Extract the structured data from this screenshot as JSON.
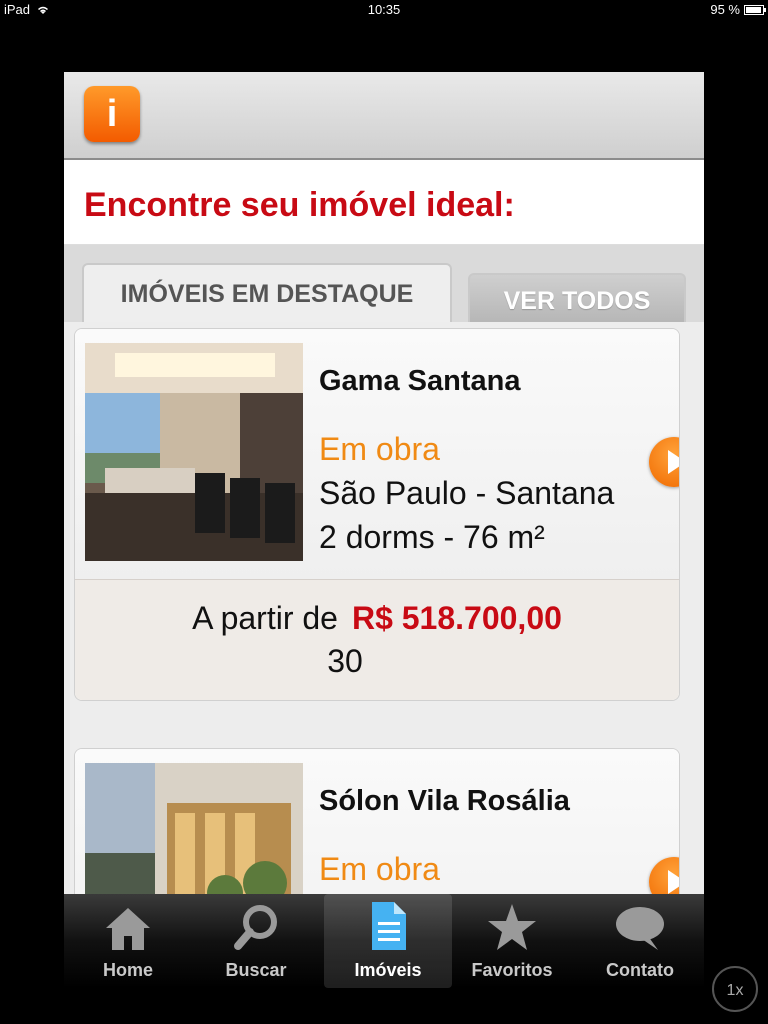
{
  "status_bar": {
    "device": "iPad",
    "time": "10:35",
    "battery": "95 %",
    "battery_level": 0.95
  },
  "header": {
    "logo_letter": "i"
  },
  "headline": "Encontre seu imóvel ideal:",
  "tabs": [
    {
      "label": "IMÓVEIS EM DESTAQUE",
      "active": true
    },
    {
      "label": "VER TODOS",
      "active": false
    }
  ],
  "listings": [
    {
      "title": "Gama Santana",
      "status": "Em obra",
      "location": "São Paulo - Santana",
      "size": "2 dorms - 76 m²",
      "price_prefix": "A partir de",
      "price": "R$ 518.700,00",
      "extra": "30"
    },
    {
      "title": "Sólon Vila Rosália",
      "status": "Em obra"
    }
  ],
  "tab_bar": [
    {
      "label": "Home",
      "icon": "home-icon"
    },
    {
      "label": "Buscar",
      "icon": "search-icon"
    },
    {
      "label": "Imóveis",
      "icon": "document-icon",
      "selected": true
    },
    {
      "label": "Favoritos",
      "icon": "star-icon"
    },
    {
      "label": "Contato",
      "icon": "chat-bubble-icon"
    }
  ],
  "zoom_label": "1x",
  "colors": {
    "brand_red": "#c80a14",
    "accent_orange": "#f08a14"
  }
}
